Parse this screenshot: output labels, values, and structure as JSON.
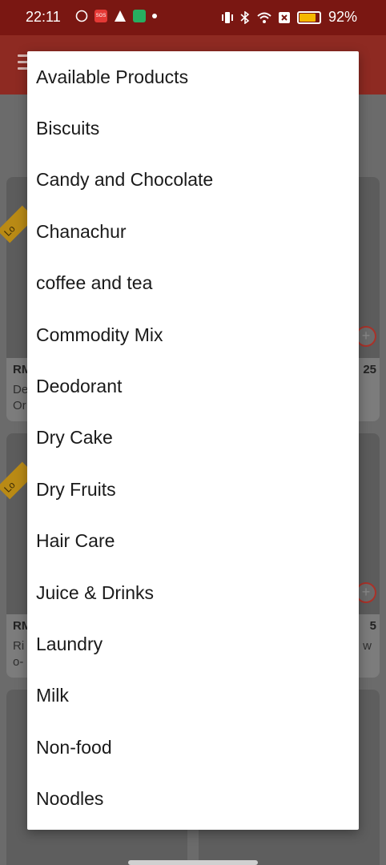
{
  "status_bar": {
    "time": "22:11",
    "battery": "92%",
    "icons": [
      "whatsapp-icon",
      "sos-icon",
      "warning-icon",
      "app-icon",
      "dot-icon",
      "vibrate-icon",
      "bluetooth-icon",
      "wifi-icon",
      "close-box-icon",
      "battery-icon"
    ]
  },
  "behind": {
    "card1_ribbon": "Lo",
    "card1_price": "RM",
    "card1_price_right": "25",
    "card1_desc_line1": "De",
    "card1_desc_line2": "Or",
    "card2_ribbon": "Lo",
    "card2_price": "RM",
    "card2_price_right": "5",
    "card2_desc_line1": "Ri",
    "card2_desc_line2": "o-",
    "card2_desc_right": "w"
  },
  "menu": {
    "items": [
      {
        "label": "Available Products"
      },
      {
        "label": "Biscuits"
      },
      {
        "label": "Candy and Chocolate"
      },
      {
        "label": "Chanachur"
      },
      {
        "label": "coffee and tea"
      },
      {
        "label": "Commodity Mix"
      },
      {
        "label": "Deodorant"
      },
      {
        "label": "Dry Cake"
      },
      {
        "label": "Dry Fruits"
      },
      {
        "label": "Hair Care"
      },
      {
        "label": "Juice & Drinks"
      },
      {
        "label": "Laundry"
      },
      {
        "label": "Milk"
      },
      {
        "label": "Non-food"
      },
      {
        "label": "Noodles"
      }
    ]
  },
  "colors": {
    "status_bar": "#7a1712",
    "header": "#8e2a22",
    "menu_bg": "#ffffff",
    "scrim": "#6b6b6b"
  }
}
